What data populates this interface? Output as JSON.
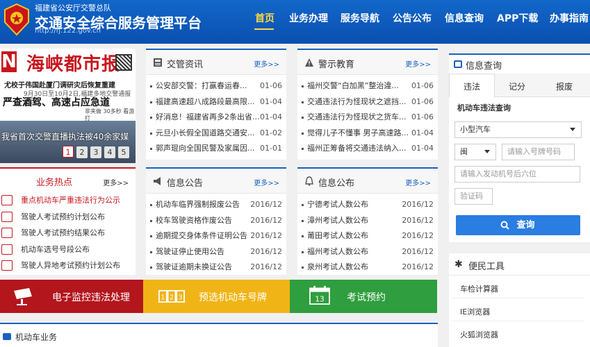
{
  "header": {
    "org": "福建省公安厅交警总队",
    "title": "交通安全综合服务管理平台",
    "url": "http://fj.122.gov.cn"
  },
  "nav": [
    "首页",
    "业务办理",
    "服务导航",
    "公告公布",
    "信息查询",
    "APP下载",
    "办事指南"
  ],
  "news": {
    "logo_letter": "N",
    "paper_name": "海峡都市报",
    "line1": "尤校于伟国赴厦门调研灾后恢复重建",
    "line2": "9月30日至10月2日,福建多地交警通报执法",
    "line3": "严查酒驾、高速占应急道",
    "line4": "非夹做 30多秒  看游打",
    "caption": "我省首次交警直播执法被40余家媒",
    "pages": [
      "1",
      "2",
      "3",
      "4",
      "5"
    ]
  },
  "jgzx": {
    "title": "交管资讯",
    "more": "更多>>",
    "items": [
      {
        "text": "公安部交警：打赢春运春...",
        "date": "01-06"
      },
      {
        "text": "福建高速超八成路段最高限...",
        "date": "01-04"
      },
      {
        "text": "好消息！福建省再多2条出省...",
        "date": "01-04"
      },
      {
        "text": "元旦小长假全国道路交通安...",
        "date": "01-02"
      },
      {
        "text": "郭声琨向全国民警及家属因...",
        "date": "01-01"
      }
    ]
  },
  "jsjy": {
    "title": "警示教育",
    "more": "更多>>",
    "items": [
      {
        "text": "福州交警“白加黑”整治違...",
        "date": "01-06"
      },
      {
        "text": "交通违法行为怪现状之遮挡...",
        "date": "01-06"
      },
      {
        "text": "交通违法行为怪现状之货车...",
        "date": "01-06"
      },
      {
        "text": "觉得儿子不懂事 男子高速路...",
        "date": "01-04"
      },
      {
        "text": "福州正筹备将交通违法纳入...",
        "date": "01-04"
      }
    ]
  },
  "ywrd": {
    "title": "业务热点",
    "more": "更多>>",
    "items": [
      "重点机动车严重违法行为公示",
      "驾驶人考试预约计划公布",
      "驾驶人考试预约结果公布",
      "机动车选号号段公布",
      "驾驶人异地考试预约计划公布"
    ]
  },
  "xxgg": {
    "title": "信息公告",
    "more": "更多>>",
    "items": [
      {
        "text": "机动车临界强制报废公告",
        "date": "2016/12"
      },
      {
        "text": "校车驾驶资格作废公告",
        "date": "2016/12"
      },
      {
        "text": "逾期提交身体条件证明公告",
        "date": "2016/12"
      },
      {
        "text": "驾驶证停止使用公告",
        "date": "2016/12"
      },
      {
        "text": "驾驶证逾期未换证公告",
        "date": "2016/12"
      }
    ]
  },
  "xxgb": {
    "title": "信息公布",
    "more": "更多>>",
    "items": [
      {
        "text": "宁德考试人数公布",
        "date": "2016/12"
      },
      {
        "text": "漳州考试人数公布",
        "date": "2016/12"
      },
      {
        "text": "莆田考试人数公布",
        "date": "2016/12"
      },
      {
        "text": "福州考试人数公布",
        "date": "2016/12"
      },
      {
        "text": "泉州考试人数公布",
        "date": "2016/12"
      }
    ]
  },
  "banners": [
    {
      "label": "电子监控违法处理",
      "color": "#b3161d"
    },
    {
      "label": "预选机动车号牌",
      "color": "#f0b416",
      "digits": "123"
    },
    {
      "label": "考试预约",
      "color": "#2f9e3e",
      "day": "13"
    }
  ],
  "vehicle": {
    "title": "机动车业务"
  },
  "info": {
    "title": "信息查询",
    "tabs": [
      "违法",
      "记分",
      "报废"
    ],
    "subtitle": "机动车违法查询",
    "vehicle_type": "小型汽车",
    "province": "闽",
    "plate_placeholder": "请输入号牌号码",
    "engine_placeholder": "请输入发动机号后六位",
    "captcha_placeholder": "验证码",
    "button": "查询"
  },
  "tools": {
    "title": "便民工具",
    "items": [
      "车检计算器",
      "IE浏览器",
      "火狐浏览器"
    ]
  }
}
